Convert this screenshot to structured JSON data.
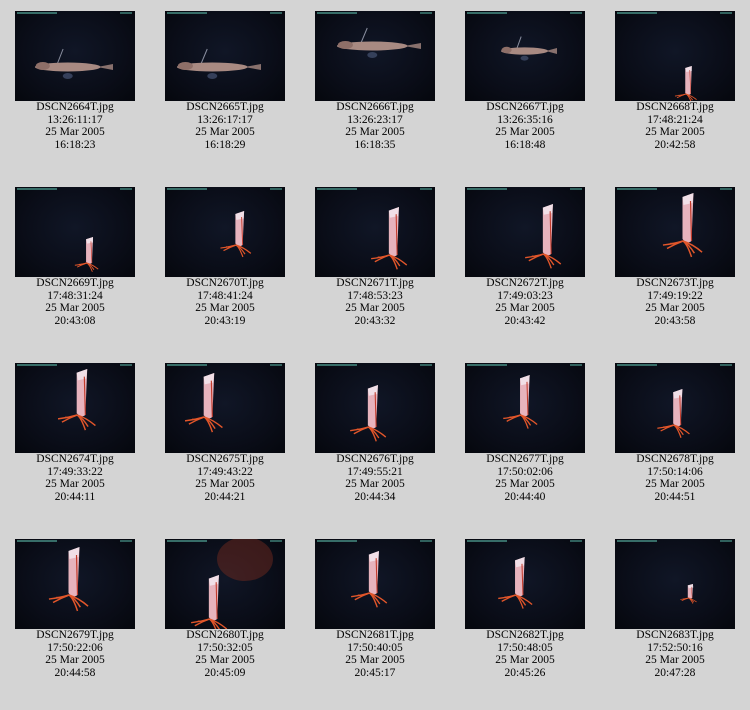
{
  "thumbnails": [
    {
      "file": "DSCN2664T.jpg",
      "time": "13:26:11:17",
      "date": "25 Mar 2005",
      "clock": "16:18:23",
      "subject": "fish"
    },
    {
      "file": "DSCN2665T.jpg",
      "time": "13:26:17:17",
      "date": "25 Mar 2005",
      "clock": "16:18:29",
      "subject": "fish"
    },
    {
      "file": "DSCN2666T.jpg",
      "time": "13:26:23:17",
      "date": "25 Mar 2005",
      "clock": "16:18:35",
      "subject": "fish"
    },
    {
      "file": "DSCN2667T.jpg",
      "time": "13:26:35:16",
      "date": "25 Mar 2005",
      "clock": "16:18:48",
      "subject": "fish"
    },
    {
      "file": "DSCN2668T.jpg",
      "time": "17:48:21:24",
      "date": "25 Mar 2005",
      "clock": "20:42:58",
      "subject": "squid"
    },
    {
      "file": "DSCN2669T.jpg",
      "time": "17:48:31:24",
      "date": "25 Mar 2005",
      "clock": "20:43:08",
      "subject": "squid"
    },
    {
      "file": "DSCN2670T.jpg",
      "time": "17:48:41:24",
      "date": "25 Mar 2005",
      "clock": "20:43:19",
      "subject": "squid"
    },
    {
      "file": "DSCN2671T.jpg",
      "time": "17:48:53:23",
      "date": "25 Mar 2005",
      "clock": "20:43:32",
      "subject": "squid"
    },
    {
      "file": "DSCN2672T.jpg",
      "time": "17:49:03:23",
      "date": "25 Mar 2005",
      "clock": "20:43:42",
      "subject": "squid"
    },
    {
      "file": "DSCN2673T.jpg",
      "time": "17:49:19:22",
      "date": "25 Mar 2005",
      "clock": "20:43:58",
      "subject": "squid"
    },
    {
      "file": "DSCN2674T.jpg",
      "time": "17:49:33:22",
      "date": "25 Mar 2005",
      "clock": "20:44:11",
      "subject": "squid"
    },
    {
      "file": "DSCN2675T.jpg",
      "time": "17:49:43:22",
      "date": "25 Mar 2005",
      "clock": "20:44:21",
      "subject": "squid"
    },
    {
      "file": "DSCN2676T.jpg",
      "time": "17:49:55:21",
      "date": "25 Mar 2005",
      "clock": "20:44:34",
      "subject": "squid"
    },
    {
      "file": "DSCN2677T.jpg",
      "time": "17:50:02:06",
      "date": "25 Mar 2005",
      "clock": "20:44:40",
      "subject": "squid"
    },
    {
      "file": "DSCN2678T.jpg",
      "time": "17:50:14:06",
      "date": "25 Mar 2005",
      "clock": "20:44:51",
      "subject": "squid"
    },
    {
      "file": "DSCN2679T.jpg",
      "time": "17:50:22:06",
      "date": "25 Mar 2005",
      "clock": "20:44:58",
      "subject": "squid"
    },
    {
      "file": "DSCN2680T.jpg",
      "time": "17:50:32:05",
      "date": "25 Mar 2005",
      "clock": "20:45:09",
      "subject": "squid"
    },
    {
      "file": "DSCN2681T.jpg",
      "time": "17:50:40:05",
      "date": "25 Mar 2005",
      "clock": "20:45:17",
      "subject": "squid"
    },
    {
      "file": "DSCN2682T.jpg",
      "time": "17:50:48:05",
      "date": "25 Mar 2005",
      "clock": "20:45:26",
      "subject": "squid"
    },
    {
      "file": "DSCN2683T.jpg",
      "time": "17:52:50:16",
      "date": "25 Mar 2005",
      "clock": "20:47:28",
      "subject": "squid"
    }
  ],
  "colors": {
    "page_background": "#d4d4d4",
    "thumbnail_background": "#0a0d18",
    "squid_body": "#e7b3bd",
    "squid_arms": "#e2562a",
    "fish_body": "#a88a82",
    "hud_text": "#3f7f77"
  }
}
